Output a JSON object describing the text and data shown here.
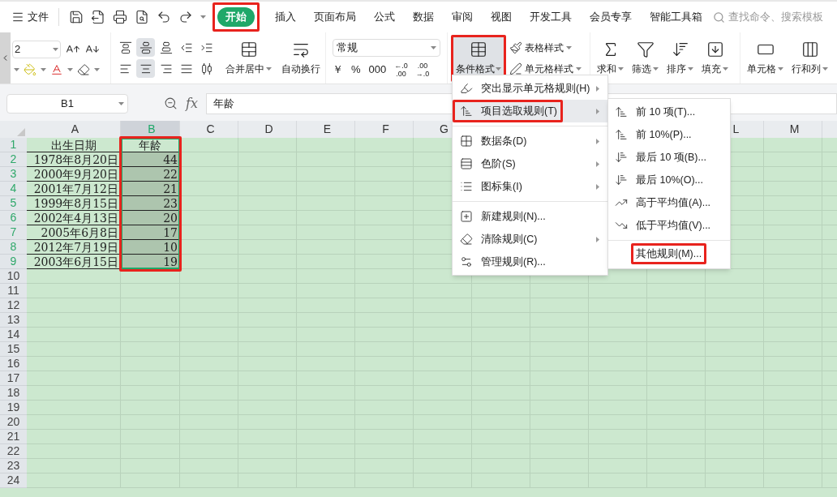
{
  "menu_bar": {
    "file_label": "文件",
    "tabs": [
      {
        "label": "开始",
        "selected": true,
        "highlighted": true
      },
      {
        "label": "插入",
        "selected": false,
        "highlighted": false
      },
      {
        "label": "页面布局",
        "selected": false,
        "highlighted": false
      },
      {
        "label": "公式",
        "selected": false,
        "highlighted": false
      },
      {
        "label": "数据",
        "selected": false,
        "highlighted": false
      },
      {
        "label": "审阅",
        "selected": false,
        "highlighted": false
      },
      {
        "label": "视图",
        "selected": false,
        "highlighted": false
      },
      {
        "label": "开发工具",
        "selected": false,
        "highlighted": false
      },
      {
        "label": "会员专享",
        "selected": false,
        "highlighted": false
      },
      {
        "label": "智能工具箱",
        "selected": false,
        "highlighted": false
      }
    ],
    "search": {
      "placeholder": "查找命令、搜索模板"
    }
  },
  "ribbon": {
    "font_size": {
      "value": "2"
    },
    "align_row_1": [
      {
        "kind": "top",
        "selected": false
      },
      {
        "kind": "middle",
        "selected": true
      },
      {
        "kind": "bottom",
        "selected": false
      },
      {
        "kind": "outdent",
        "selected": false
      },
      {
        "kind": "indent",
        "selected": false
      }
    ],
    "align_row_2": [
      {
        "kind": "left",
        "selected": false
      },
      {
        "kind": "center",
        "selected": true
      },
      {
        "kind": "right",
        "selected": false
      },
      {
        "kind": "justify",
        "selected": false
      },
      {
        "kind": "distribute",
        "selected": false
      }
    ],
    "merge": {
      "label": "合并居中"
    },
    "wrap": {
      "label": "自动换行"
    },
    "number_format": {
      "value": "常规"
    },
    "number_buttons": [
      {
        "kind": "text",
        "label": "￥"
      },
      {
        "kind": "text",
        "label": "%"
      },
      {
        "kind": "text",
        "label": "000"
      },
      {
        "kind": "decimal",
        "top": "←.0",
        "bottom": ".00"
      },
      {
        "kind": "decimal",
        "top": ".00",
        "bottom": "→.0"
      }
    ],
    "conditional_format": {
      "label": "条件格式",
      "selected": true,
      "highlighted": true
    },
    "styles": [
      {
        "kind": "table",
        "label": "表格样式"
      },
      {
        "kind": "cell",
        "label": "单元格样式"
      }
    ],
    "tools": [
      {
        "kind": "sum",
        "label": "求和"
      },
      {
        "kind": "filter",
        "label": "筛选"
      },
      {
        "kind": "sort",
        "label": "排序"
      },
      {
        "kind": "fill",
        "label": "填充"
      }
    ],
    "cell_tools": [
      {
        "kind": "cell",
        "label": "单元格"
      },
      {
        "kind": "rowcol",
        "label": "行和列"
      }
    ]
  },
  "formula_bar": {
    "name_box": "B1",
    "fx_label": "fx",
    "value": "年龄"
  },
  "sheet": {
    "selection_highlighted": true,
    "columns": [
      {
        "label": "A",
        "selected": false
      },
      {
        "label": "B",
        "selected": true
      },
      {
        "label": "C",
        "selected": false
      },
      {
        "label": "D",
        "selected": false
      },
      {
        "label": "E",
        "selected": false
      },
      {
        "label": "F",
        "selected": false
      },
      {
        "label": "G",
        "selected": false
      },
      {
        "label": "L",
        "selected": false
      },
      {
        "label": "M",
        "selected": false
      }
    ],
    "rows": [
      {
        "label": "1",
        "selected": true,
        "cells": [
          {
            "text": "出生日期",
            "selected": false
          },
          {
            "text": "年龄",
            "selected": false
          }
        ]
      },
      {
        "label": "2",
        "selected": true,
        "cells": [
          {
            "text": "1978年8月20日",
            "selected": false
          },
          {
            "text": "44",
            "selected": true
          }
        ]
      },
      {
        "label": "3",
        "selected": true,
        "cells": [
          {
            "text": "2000年9月20日",
            "selected": false
          },
          {
            "text": "22",
            "selected": true
          }
        ]
      },
      {
        "label": "4",
        "selected": true,
        "cells": [
          {
            "text": "2001年7月12日",
            "selected": false
          },
          {
            "text": "21",
            "selected": true
          }
        ]
      },
      {
        "label": "5",
        "selected": true,
        "cells": [
          {
            "text": "1999年8月15日",
            "selected": false
          },
          {
            "text": "23",
            "selected": true
          }
        ]
      },
      {
        "label": "6",
        "selected": true,
        "cells": [
          {
            "text": "2002年4月13日",
            "selected": false
          },
          {
            "text": "20",
            "selected": true
          }
        ]
      },
      {
        "label": "7",
        "selected": true,
        "cells": [
          {
            "text": "2005年6月8日",
            "selected": false
          },
          {
            "text": "17",
            "selected": true
          }
        ]
      },
      {
        "label": "8",
        "selected": true,
        "cells": [
          {
            "text": "2012年7月19日",
            "selected": false
          },
          {
            "text": "10",
            "selected": true
          }
        ]
      },
      {
        "label": "9",
        "selected": true,
        "cells": [
          {
            "text": "2003年6月15日",
            "selected": false
          },
          {
            "text": "19",
            "selected": true
          }
        ]
      },
      {
        "label": "10",
        "selected": false
      },
      {
        "label": "11",
        "selected": false
      },
      {
        "label": "12",
        "selected": false
      },
      {
        "label": "13",
        "selected": false
      },
      {
        "label": "14",
        "selected": false
      },
      {
        "label": "15",
        "selected": false
      },
      {
        "label": "16",
        "selected": false
      },
      {
        "label": "17",
        "selected": false
      },
      {
        "label": "18",
        "selected": false
      },
      {
        "label": "19",
        "selected": false
      },
      {
        "label": "20",
        "selected": false
      },
      {
        "label": "21",
        "selected": false
      },
      {
        "label": "22",
        "selected": false
      },
      {
        "label": "23",
        "selected": false
      },
      {
        "label": "24",
        "selected": false
      }
    ]
  },
  "context_menu": {
    "items": [
      {
        "kind": "highlight",
        "label": "突出显示单元格规则(H)",
        "has_submenu": true,
        "selected": false,
        "highlighted": false,
        "separator_before": false
      },
      {
        "kind": "top",
        "label": "项目选取规则(T)",
        "has_submenu": true,
        "selected": true,
        "highlighted": true,
        "separator_before": false
      },
      {
        "kind": "databar",
        "label": "数据条(D)",
        "has_submenu": true,
        "selected": false,
        "highlighted": false,
        "separator_before": true
      },
      {
        "kind": "scale",
        "label": "色阶(S)",
        "has_submenu": true,
        "selected": false,
        "highlighted": false,
        "separator_before": false
      },
      {
        "kind": "iconset",
        "label": "图标集(I)",
        "has_submenu": true,
        "selected": false,
        "highlighted": false,
        "separator_before": false
      },
      {
        "kind": "new",
        "label": "新建规则(N)...",
        "has_submenu": false,
        "selected": false,
        "highlighted": false,
        "separator_before": true
      },
      {
        "kind": "clear",
        "label": "清除规则(C)",
        "has_submenu": true,
        "selected": false,
        "highlighted": false,
        "separator_before": false
      },
      {
        "kind": "manage",
        "label": "管理规则(R)...",
        "has_submenu": false,
        "selected": false,
        "highlighted": false,
        "separator_before": false
      }
    ]
  },
  "submenu": {
    "items": [
      {
        "kind": "top",
        "label": "前 10 项(T)...",
        "highlighted": false,
        "separator_before": false
      },
      {
        "kind": "top",
        "label": "前 10%(P)...",
        "highlighted": false,
        "separator_before": false
      },
      {
        "kind": "bottom",
        "label": "最后 10 项(B)...",
        "highlighted": false,
        "separator_before": false
      },
      {
        "kind": "bottom",
        "label": "最后 10%(O)...",
        "highlighted": false,
        "separator_before": false
      },
      {
        "kind": "above",
        "label": "高于平均值(A)...",
        "highlighted": false,
        "separator_before": false
      },
      {
        "kind": "below",
        "label": "低于平均值(V)...",
        "highlighted": false,
        "separator_before": false
      },
      {
        "kind": "none",
        "label": "其他规则(M)...",
        "highlighted": true,
        "separator_before": true
      }
    ]
  }
}
